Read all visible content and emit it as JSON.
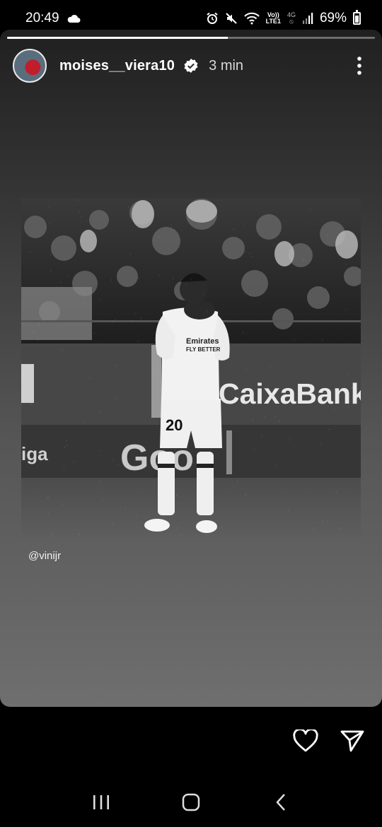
{
  "status_bar": {
    "time": "20:49",
    "lte_top": "Vo))",
    "lte_bottom": "LTE1",
    "network_top": "4G",
    "battery": "69%",
    "icons": [
      "cloud-icon",
      "alarm-icon",
      "mute-icon",
      "wifi-icon",
      "volte-icon",
      "data-icon",
      "signal-icon",
      "battery-icon"
    ]
  },
  "story": {
    "progress": 0.6,
    "username": "moises__viera10",
    "time_ago": "3 min",
    "mention": "@vinijr",
    "photo": {
      "board_text": "CaixaBank",
      "ad_text": "Goo",
      "liga_text": "iga",
      "shirt_number": "20",
      "shirt_sponsor": "Emirates",
      "shirt_sponsor2": "FLY BETTER"
    }
  },
  "actions": {
    "icons": [
      "heart-icon",
      "send-icon"
    ]
  },
  "nav": {
    "icons": [
      "recent-apps-icon",
      "home-icon",
      "back-icon"
    ]
  },
  "colors": {
    "background": "#000000",
    "text": "#ffffff"
  }
}
